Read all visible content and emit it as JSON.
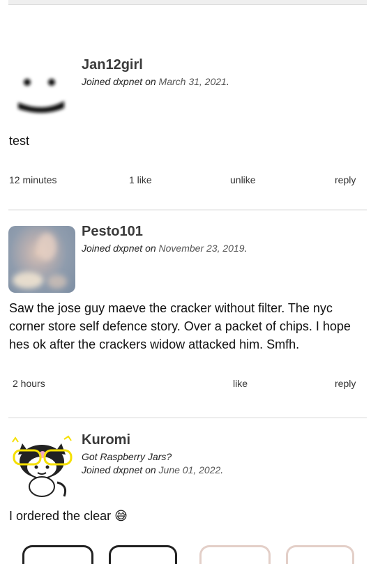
{
  "comments": [
    {
      "username": "Jan12girl",
      "subtitle": "",
      "joined_prefix": "Joined dxpnet on ",
      "joined_date": "March 31, 2021",
      "joined_suffix": ".",
      "text": "test",
      "time": "12 minutes",
      "likes": "1 like",
      "like_action": "unlike",
      "reply": "reply"
    },
    {
      "username": "Pesto101",
      "subtitle": "",
      "joined_prefix": "Joined dxpnet on ",
      "joined_date": "November 23, 2019",
      "joined_suffix": ".",
      "text": "Saw the jose guy maeve the cracker without filter. The nyc corner store self defence story. Over a packet of chips. I hope hes ok after the crackers widow attacked him. Smfh.",
      "time": "2 hours",
      "like_action": "like",
      "reply": "reply"
    },
    {
      "username": "Kuromi",
      "subtitle": "Got Raspberry Jars?",
      "joined_prefix": "Joined dxpnet on ",
      "joined_date": "June 01, 2022",
      "joined_suffix": ".",
      "text": "I ordered the clear 😅"
    }
  ]
}
